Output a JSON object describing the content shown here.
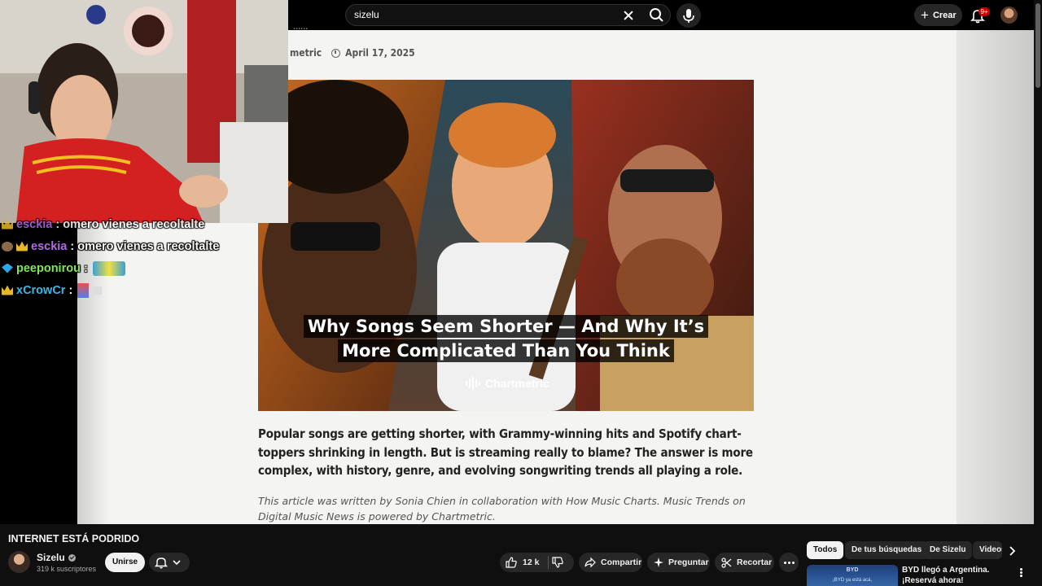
{
  "topbar": {
    "search_value": "sizelu",
    "create_label": "Crear",
    "notif_count": "9+",
    "icons": [
      "close-icon",
      "search-icon",
      "mic-icon",
      "plus-icon",
      "bell-icon",
      "avatar"
    ]
  },
  "article": {
    "author_fragment": "metric",
    "top_fragment": "......",
    "date": "April 17, 2025",
    "hero_caption_line1": "Why Songs Seem Shorter — And Why It’s",
    "hero_caption_line2": "More Complicated Than You Think",
    "hero_brand": "Chartmetric",
    "lead": "Popular songs are getting shorter, with Grammy-winning hits and Spotify chart-toppers shrinking in length. But is streaming really to blame? The answer is more complex, with history, genre, and evolving songwriting trends all playing a role.",
    "note": "This article was written by Sonia Chien in collaboration with How Music Charts. Music Trends on Digital Music News is powered by Chartmetric."
  },
  "chat": [
    {
      "user": "esckia",
      "msg": "omero vienes a recoltalte",
      "color": "#b06ae8",
      "badge": "crown"
    },
    {
      "user": "esckia",
      "msg": "omero vienes a recoltalte",
      "color": "#b06ae8",
      "badge": "crown"
    },
    {
      "user": "peeponirou",
      "msg": ":",
      "color": "#7ee85a",
      "badge": "gem"
    },
    {
      "user": "xCrowCr",
      "msg": ":",
      "color": "#3ab8e8",
      "badge": "crown"
    }
  ],
  "video": {
    "title": "INTERNET ESTÁ PODRIDO",
    "channel": "Sizelu",
    "subscribers": "319 k suscriptores",
    "join_label": "Unirse",
    "likes": "12 k",
    "share_label": "Compartir",
    "ask_label": "Preguntar",
    "clip_label": "Recortar"
  },
  "chips": [
    "Todos",
    "De tus búsquedas",
    "De Sizelu",
    "Videos"
  ],
  "recommendation": {
    "title": "BYD llegó a Argentina. ¡Reservá ahora!",
    "thumb_brand": "BYD",
    "thumb_text": "¡BYD ya está acá,"
  },
  "colors": {
    "bg": "#0f0f0f",
    "pill": "#272727",
    "accent_red": "#cc0000"
  }
}
